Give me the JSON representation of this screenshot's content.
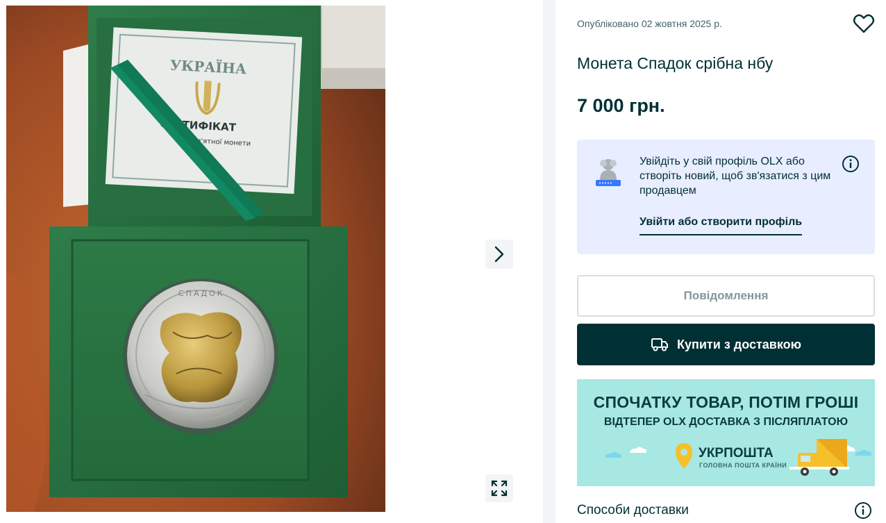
{
  "listing": {
    "published": "Опубліковано 02 жовтня 2025 р.",
    "title": "Монета Спадок срібна нбу",
    "price": "7 000 грн."
  },
  "photo": {
    "certificate_country": "УКРАЇНА",
    "certificate_title": "СЕРТИФІКАТ",
    "certificate_line": "пам'ятної монети",
    "coin_inscription": "СПАДОК"
  },
  "login": {
    "message": "Увійдіть у свій профіль OLX або створіть новий, щоб зв'язатися з цим продавцем",
    "link": "Увійти або створити профіль"
  },
  "actions": {
    "message_button": "Повідомлення",
    "buy_button": "Купити з доставкою"
  },
  "banner": {
    "headline": "СПОЧАТКУ ТОВАР, ПОТІМ ГРОШІ",
    "subline": "ВІДТЕПЕР OLX ДОСТАВКА З ПІСЛЯПЛАТОЮ",
    "brand": "УКРПОШТА",
    "brand_tagline": "ГОЛОВНА ПОШТА КРАЇНИ"
  },
  "delivery": {
    "title": "Способи доставки"
  },
  "icons": {
    "next": "chevron-right-icon",
    "expand": "expand-icon",
    "favorite": "heart-icon",
    "info": "info-icon",
    "truck": "truck-icon",
    "avatar": "user-avatar-icon"
  },
  "colors": {
    "primary": "#002f34",
    "login_bg": "#e8eeff",
    "banner_bg": "#a7e8e3",
    "ukrposhta_yellow": "#f6c02a"
  }
}
